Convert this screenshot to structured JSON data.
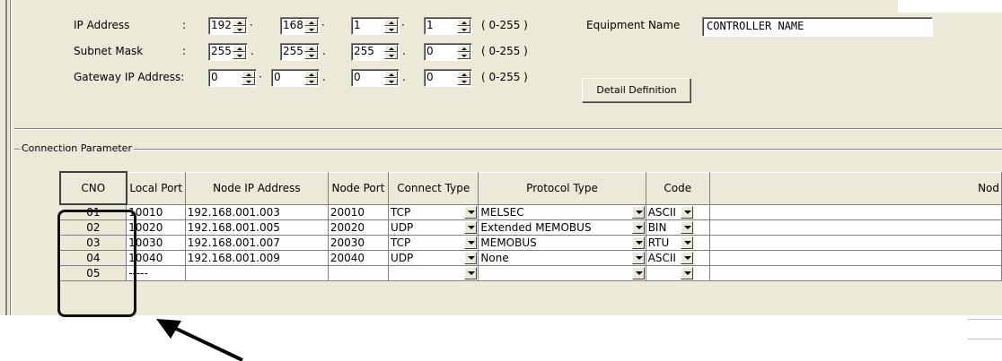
{
  "ip_settings": {
    "ip_address": {
      "label": "IP Address",
      "octets": [
        "192",
        "168",
        "1",
        "1"
      ]
    },
    "subnet_mask": {
      "label": "Subnet Mask",
      "octets": [
        "255",
        "255",
        "255",
        "0"
      ]
    },
    "gateway": {
      "label": "Gateway IP Address:",
      "octets": [
        "0",
        "0",
        "0",
        "0"
      ]
    },
    "colon": ":",
    "range": "( 0-255 )",
    "equipment_name_label": "Equipment Name",
    "equipment_name_value": "CONTROLLER NAME",
    "detail_button": "Detail Definition"
  },
  "connection": {
    "group_label": "Connection Parameter",
    "headers": [
      "CNO",
      "Local Port",
      "Node IP Address",
      "Node Port",
      "Connect Type",
      "Protocol Type",
      "Code",
      "Nod"
    ],
    "rows": [
      {
        "cno": "01",
        "local": "10010",
        "ip": "192.168.001.003",
        "node": "20010",
        "connect": "TCP",
        "protocol": "MELSEC",
        "code": "ASCII"
      },
      {
        "cno": "02",
        "local": "10020",
        "ip": "192.168.001.005",
        "node": "20020",
        "connect": "UDP",
        "protocol": "Extended MEMOBUS",
        "code": "BIN"
      },
      {
        "cno": "03",
        "local": "10030",
        "ip": "192.168.001.007",
        "node": "20030",
        "connect": "TCP",
        "protocol": "MEMOBUS",
        "code": "RTU"
      },
      {
        "cno": "04",
        "local": "10040",
        "ip": "192.168.001.009",
        "node": "20040",
        "connect": "UDP",
        "protocol": "None",
        "code": "ASCII"
      },
      {
        "cno": "05",
        "local": "-----",
        "ip": "",
        "node": "",
        "connect": "",
        "protocol": "",
        "code": ""
      }
    ]
  },
  "icons": {
    "spin": "spin-updown-icon",
    "dropdown": "chevron-down-icon",
    "annotation": "pointer-arrow-icon"
  }
}
